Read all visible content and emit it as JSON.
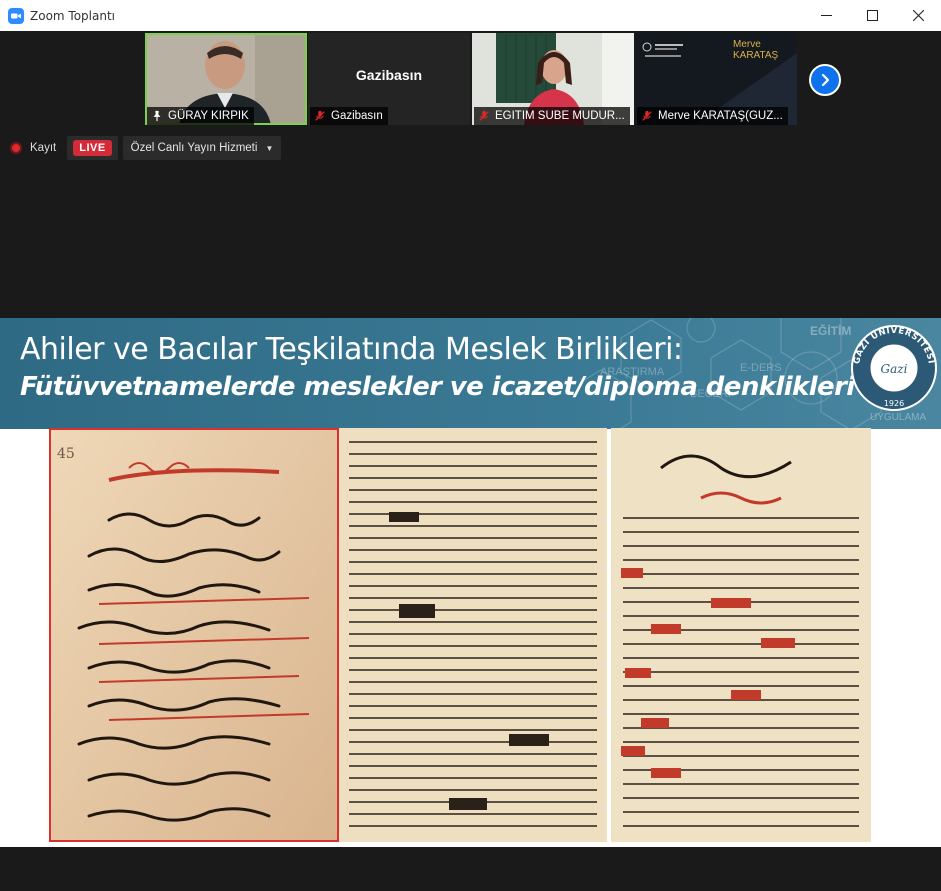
{
  "window": {
    "title": "Zoom Toplantı"
  },
  "participants": [
    {
      "name": "GÜRAY KIRPIK",
      "icon": "pin-icon",
      "active": true
    },
    {
      "name": "Gazibasın",
      "icon": "mic-muted-icon",
      "center_label": "Gazibasın"
    },
    {
      "name": "EGITIM SUBE MUDUR...",
      "icon": "mic-muted-icon"
    },
    {
      "name": "Merve KARATAŞ(GUZ...",
      "icon": "mic-muted-icon",
      "overlay_text": "Merve KARATAŞ"
    }
  ],
  "recording": {
    "label": "Kayıt",
    "live_label": "LIVE",
    "stream_service": "Özel Canlı Yayın Hizmeti"
  },
  "slide": {
    "title": "Ahiler ve Bacılar Teşkilatında Meslek Birlikleri:",
    "subtitle": "Fütüvvetnamelerde meslekler ve icazet/diploma denklikleri",
    "seal_text_top": "GAZİ ÜNİVERSİTESİ",
    "seal_year": "1926",
    "seal_center": "Gazi",
    "background_words": [
      "EĞİTİM",
      "E-DERS",
      "BECERİ",
      "ARAŞTIRMA",
      "UYGULAMA"
    ]
  },
  "colors": {
    "accent": "#0e72ed",
    "live": "#d42b38",
    "active_border": "#7fd14b",
    "banner": "#3a7994"
  }
}
